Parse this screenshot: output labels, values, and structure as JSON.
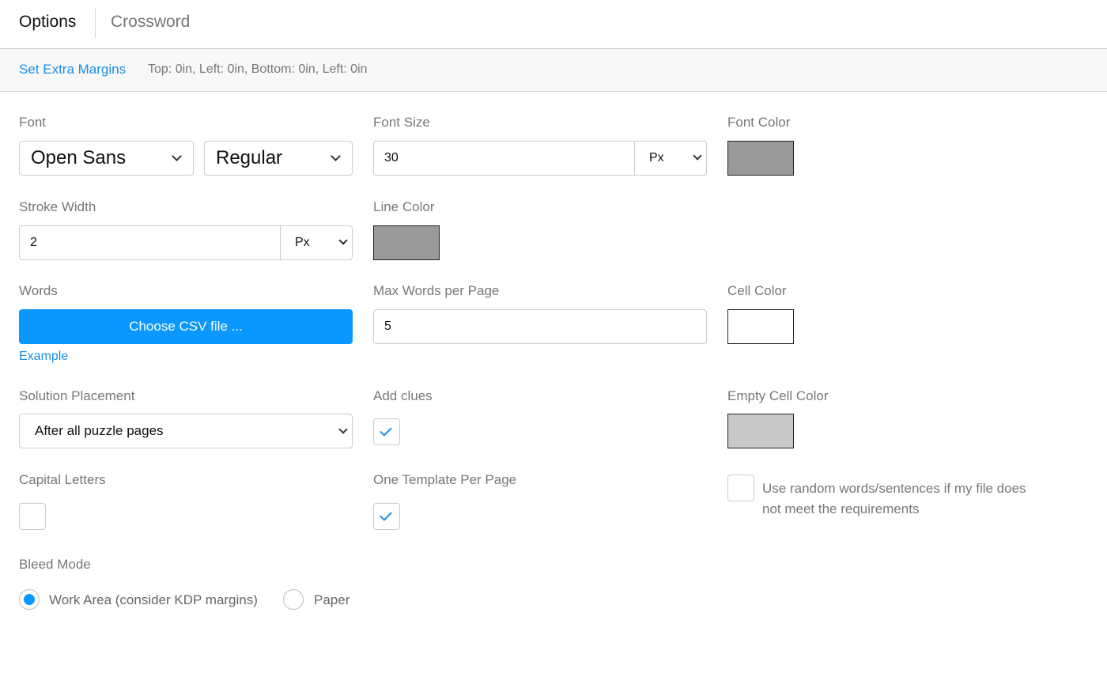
{
  "tabs": {
    "active": "Options",
    "inactive": "Crossword"
  },
  "margins": {
    "link": "Set Extra Margins",
    "info": "Top: 0in, Left: 0in, Bottom: 0in, Left: 0in"
  },
  "font": {
    "label": "Font",
    "family": "Open Sans",
    "weight": "Regular"
  },
  "font_size": {
    "label": "Font Size",
    "value": "30",
    "unit": "Px"
  },
  "font_color": {
    "label": "Font Color",
    "color": "#999999"
  },
  "stroke_width": {
    "label": "Stroke Width",
    "value": "2",
    "unit": "Px"
  },
  "line_color": {
    "label": "Line Color",
    "color": "#999999"
  },
  "words": {
    "label": "Words",
    "button": "Choose CSV file ...",
    "example": "Example"
  },
  "max_words": {
    "label": "Max Words per Page",
    "value": "5"
  },
  "cell_color": {
    "label": "Cell Color",
    "color": "#ffffff"
  },
  "solution": {
    "label": "Solution Placement",
    "value": "After all puzzle pages"
  },
  "add_clues": {
    "label": "Add clues",
    "checked": true
  },
  "empty_cell_color": {
    "label": "Empty Cell Color",
    "color": "#c8c8c8"
  },
  "capital_letters": {
    "label": "Capital Letters",
    "checked": false
  },
  "one_template": {
    "label": "One Template Per Page",
    "checked": true
  },
  "random_words": {
    "line1": "Use random words/sentences if my file does",
    "line2": "not meet the requirements",
    "checked": false
  },
  "bleed": {
    "label": "Bleed Mode",
    "option1": "Work Area (consider KDP margins)",
    "option2": "Paper",
    "selected": "option1"
  },
  "colors": {
    "accent": "#0a97ff",
    "link": "#1a8fe3"
  }
}
